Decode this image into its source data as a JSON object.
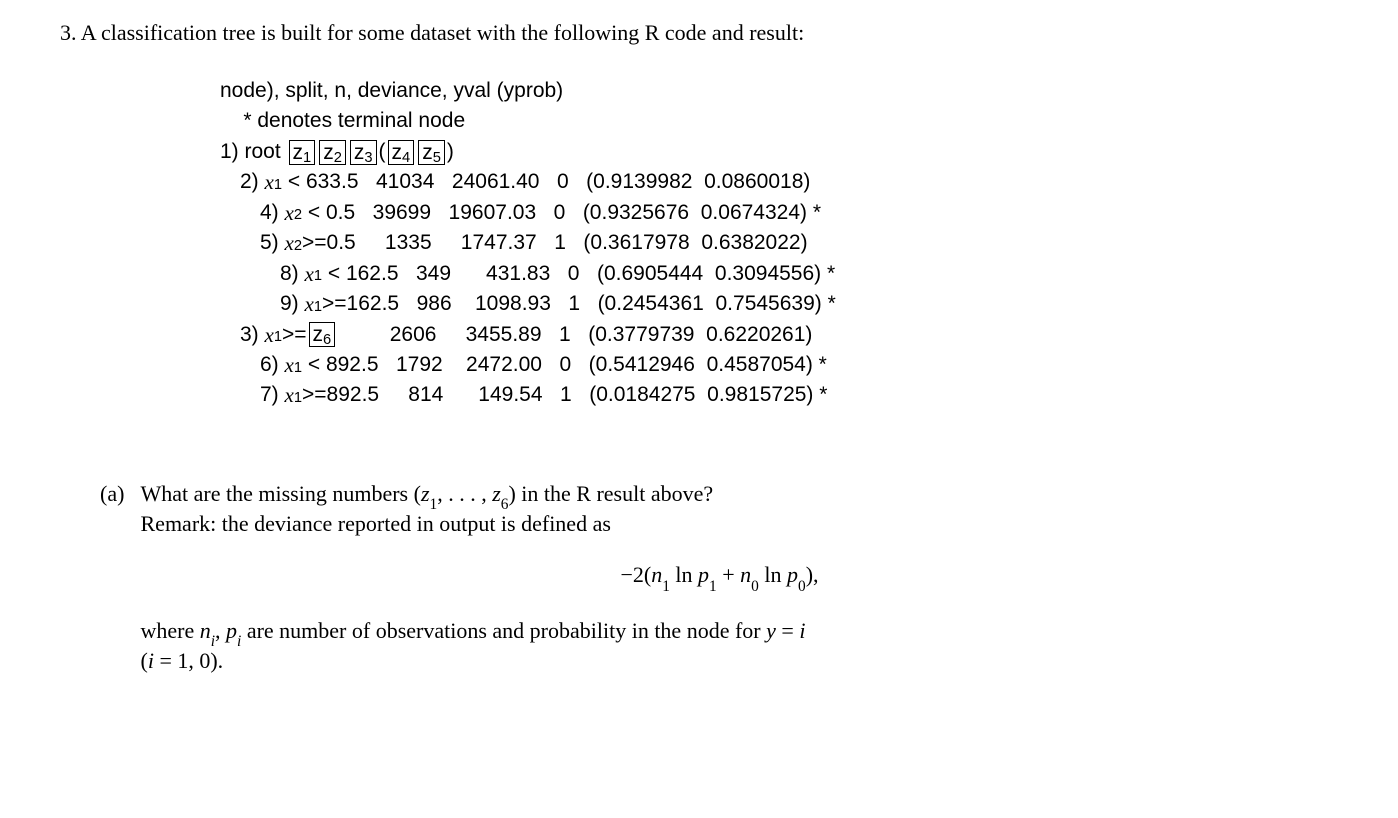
{
  "problem": {
    "number": "3.",
    "intro": "A classification tree is built for some dataset with the following R code and result:"
  },
  "tree": {
    "header1": "node), split, n, deviance, yval (yprob)",
    "header2_pre": "    * denotes terminal node",
    "root_label": "1) root ",
    "z1": "z",
    "z1sub": "1",
    "z2": "z",
    "z2sub": "2",
    "z3": "z",
    "z3sub": "3",
    "z4": "z",
    "z4sub": "4",
    "z5": "z",
    "z5sub": "5",
    "paren_open": "(",
    "paren_close": ")",
    "line2_pre": "2) ",
    "line2_var": "x",
    "line2_sub": "1",
    "line2_rest": " < 633.5   41034   24061.40   0   (0.9139982  0.0860018)",
    "line4_pre": "4) ",
    "line4_var": "x",
    "line4_sub": "2",
    "line4_rest": " < 0.5   39699   19607.03   0   (0.9325676  0.0674324) *",
    "line5_pre": "5) ",
    "line5_var": "x",
    "line5_sub": "2",
    "line5_rest": ">=0.5     1335     1747.37   1   (0.3617978  0.6382022)",
    "line8_pre": "8) ",
    "line8_var": "x",
    "line8_sub": "1",
    "line8_rest": " < 162.5   349      431.83   0   (0.6905444  0.3094556) *",
    "line9_pre": "9) ",
    "line9_var": "x",
    "line9_sub": "1",
    "line9_rest": ">=162.5   986    1098.93   1   (0.2454361  0.7545639) *",
    "line3_pre": "3) ",
    "line3_var": "x",
    "line3_sub": "1",
    "line3_mid": ">=",
    "z6": "z",
    "z6sub": "6",
    "line3_rest": "         2606     3455.89   1   (0.3779739  0.6220261)",
    "line6_pre": "6) ",
    "line6_var": "x",
    "line6_sub": "1",
    "line6_rest": " < 892.5   1792    2472.00   0   (0.5412946  0.4587054) *",
    "line7_pre": "7) ",
    "line7_var": "x",
    "line7_sub": "1",
    "line7_rest": ">=892.5     814      149.54   1   (0.0184275  0.9815725) *"
  },
  "partA": {
    "label": "(a)",
    "text1_a": "What are the missing numbers (",
    "z1v": "z",
    "z1s": "1",
    "text1_mid": ", . . . , ",
    "z6v": "z",
    "z6s": "6",
    "text1_b": ") in the R result above?",
    "text2": "Remark: the deviance reported in output is defined as",
    "formula_pre": "−2(",
    "f_n1": "n",
    "f_n1s": "1",
    "f_ln1": " ln ",
    "f_p1": "p",
    "f_p1s": "1",
    "f_plus": " + ",
    "f_n0": "n",
    "f_n0s": "0",
    "f_ln0": " ln ",
    "f_p0": "p",
    "f_p0s": "0",
    "formula_post": "),",
    "post1": "where ",
    "post_ni_n": "n",
    "post_ni_i": "i",
    "post_comma": ", ",
    "post_pi_p": "p",
    "post_pi_i": "i",
    "post2": " are number of observations and probability in the node for ",
    "post_y": "y",
    "post_eq": " = ",
    "post_i": "i",
    "post3a": "(",
    "post_i2": "i",
    "post3b": " = 1, 0)."
  }
}
